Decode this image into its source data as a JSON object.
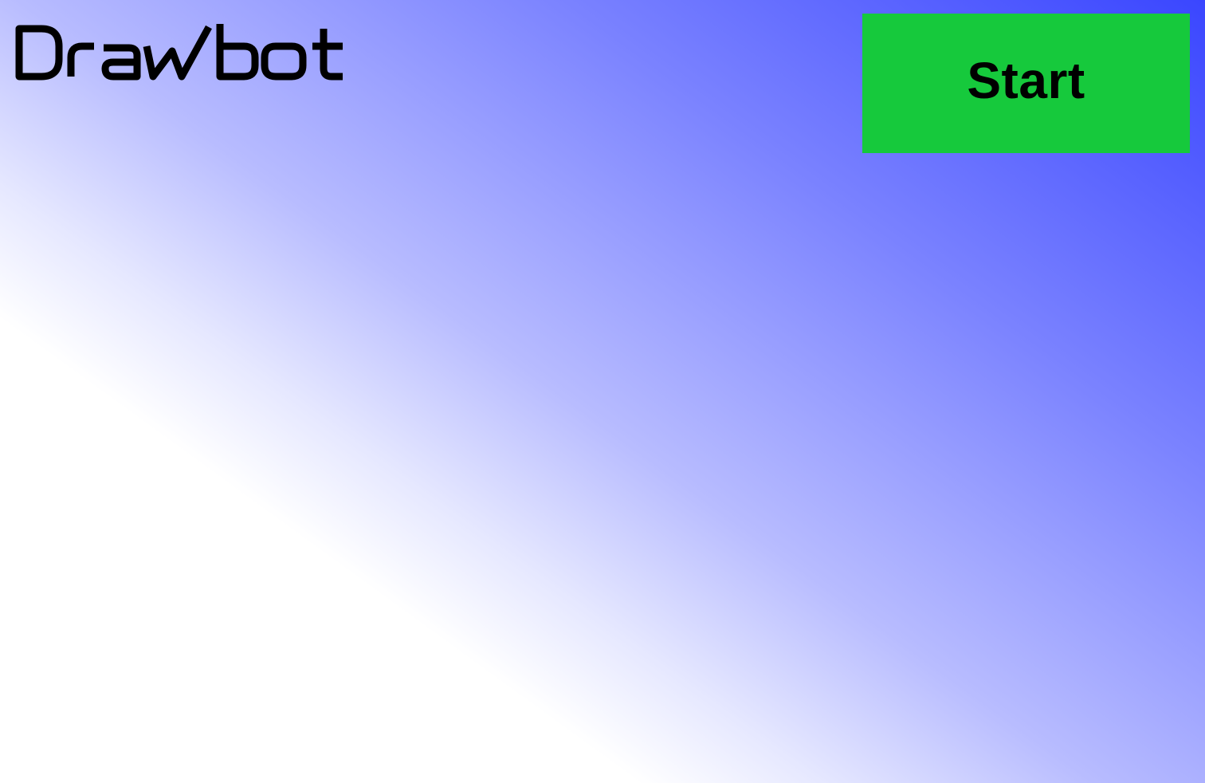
{
  "app": {
    "logo_text": "Drawbot"
  },
  "header": {
    "start_label": "Start"
  },
  "colors": {
    "gradient_start": "#3a46ff",
    "gradient_end": "#ffffff",
    "start_button_bg": "#16c93c",
    "text": "#000000"
  }
}
